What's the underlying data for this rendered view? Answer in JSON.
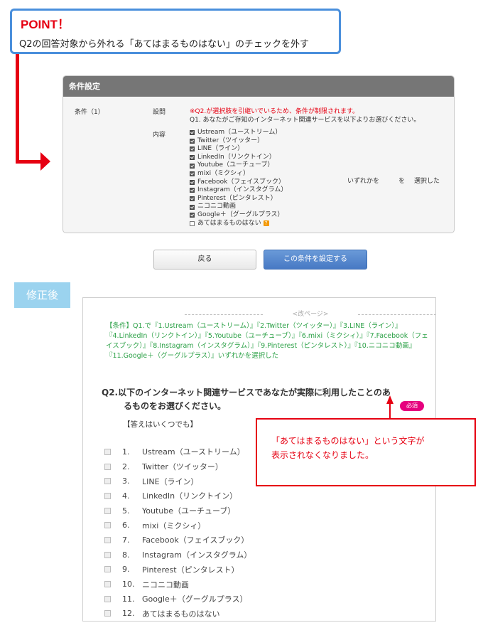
{
  "point": {
    "title": "POINT！",
    "text": "Q2の回答対象から外れる「あてはまるものはない」のチェックを外す"
  },
  "condition_panel": {
    "header": "条件設定",
    "condition_label": "条件（1）",
    "question_label": "設問",
    "warning": "※Q2.が選択肢を引継いでいるため、条件が制限されます。",
    "question_text": "Q1. あなたがご存知のインターネット関連サービスを以下よりお選びください。",
    "content_label": "内容",
    "options": [
      {
        "label": "Ustream（ユーストリーム）",
        "checked": true
      },
      {
        "label": "Twitter（ツイッター）",
        "checked": true
      },
      {
        "label": "LINE（ライン）",
        "checked": true
      },
      {
        "label": "LinkedIn（リンクトイン）",
        "checked": true
      },
      {
        "label": "Youtube（ユーチューブ）",
        "checked": true
      },
      {
        "label": "mixi（ミクシィ）",
        "checked": true
      },
      {
        "label": "Facebook（フェイスブック）",
        "checked": true
      },
      {
        "label": "Instagram（インスタグラム）",
        "checked": true
      },
      {
        "label": "Pinterest（ピンタレスト）",
        "checked": true
      },
      {
        "label": "ニコニコ動画",
        "checked": true
      },
      {
        "label": "Google＋（グーグルプラス）",
        "checked": true
      },
      {
        "label": "あてはまるものはない",
        "checked": false
      }
    ],
    "any_label": "いずれかを",
    "wo_label": "を",
    "selected_label": "選択した"
  },
  "buttons": {
    "back": "戻る",
    "set_condition": "この条件を設定する"
  },
  "after_label": "修正後",
  "preview": {
    "page_break": "<改ページ>",
    "condition_text": "【条件】Q1.で『1.Ustream（ユーストリーム）』『2.Twitter（ツイッター）』『3.LINE（ライン）』『4.LinkedIn（リンクトイン）』『5.Youtube（ユーチューブ）』『6.mixi（ミクシィ）』『7.Facebook（フェイスブック）』『8.Instagram（インスタグラム）』『9.Pinterest（ピンタレスト）』『10.ニコニコ動画』『11.Google＋（グーグルプラス）』いずれかを選択した",
    "question_line1": "Q2.以下のインターネット関連サービスであなたが実際に利用したことのあ",
    "question_line2": "るものをお選びください。",
    "required": "必須",
    "hint": "【答えはいくつでも】",
    "answers": [
      {
        "num": "1.",
        "label": "Ustream（ユーストリーム）"
      },
      {
        "num": "2.",
        "label": "Twitter（ツイッター）"
      },
      {
        "num": "3.",
        "label": "LINE（ライン）"
      },
      {
        "num": "4.",
        "label": "LinkedIn（リンクトイン）"
      },
      {
        "num": "5.",
        "label": "Youtube（ユーチューブ）"
      },
      {
        "num": "6.",
        "label": "mixi（ミクシィ）"
      },
      {
        "num": "7.",
        "label": "Facebook（フェイスブック）"
      },
      {
        "num": "8.",
        "label": "Instagram（インスタグラム）"
      },
      {
        "num": "9.",
        "label": "Pinterest（ピンタレスト）"
      },
      {
        "num": "10.",
        "label": "ニコニコ動画"
      },
      {
        "num": "11.",
        "label": "Google＋（グーグルプラス）"
      },
      {
        "num": "12.",
        "label": "あてはまるものはない"
      }
    ]
  },
  "callout": {
    "line1": "「あてはまるものはない」という文字が",
    "line2": "表示されなくなりました。"
  },
  "colors": {
    "accent_red": "#e60012",
    "point_border": "#4a8fdc",
    "condition_green": "#2ca147",
    "required_pink": "#e6007e"
  }
}
